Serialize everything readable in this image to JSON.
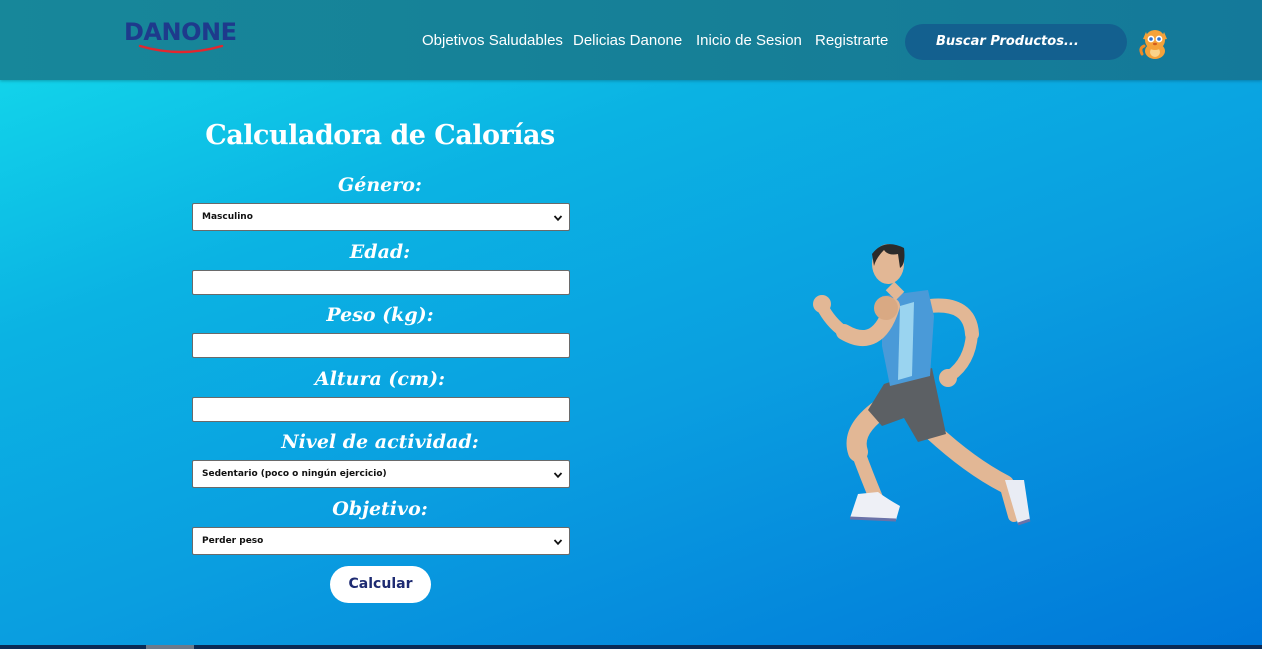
{
  "brand": {
    "logo": "DANONE"
  },
  "nav": {
    "links": [
      "Objetivos Saludables",
      "Delicias Danone",
      "Inicio de Sesion",
      "Registrarte"
    ],
    "search_placeholder": "Buscar Productos...",
    "mascot_icon": "cat-mascot-icon"
  },
  "calculator": {
    "title": "Calculadora de Calorías",
    "gender": {
      "label": "Género:",
      "value": "Masculino"
    },
    "age": {
      "label": "Edad:",
      "value": ""
    },
    "weight": {
      "label": "Peso (kg):",
      "value": ""
    },
    "height": {
      "label": "Altura (cm):",
      "value": ""
    },
    "activity": {
      "label": "Nivel de actividad:",
      "value": "Sedentario (poco o ningún ejercicio)"
    },
    "goal": {
      "label": "Objetivo:",
      "value": "Perder peso"
    },
    "submit_label": "Calcular"
  },
  "illustration": {
    "icon": "running-man-icon"
  },
  "colors": {
    "navbar": "#17879a",
    "search_bg": "#13608f",
    "hero_start": "#12d3ea",
    "hero_end": "#0077d9",
    "button_text": "#1e2b72",
    "logo": "#1e3a8c"
  }
}
